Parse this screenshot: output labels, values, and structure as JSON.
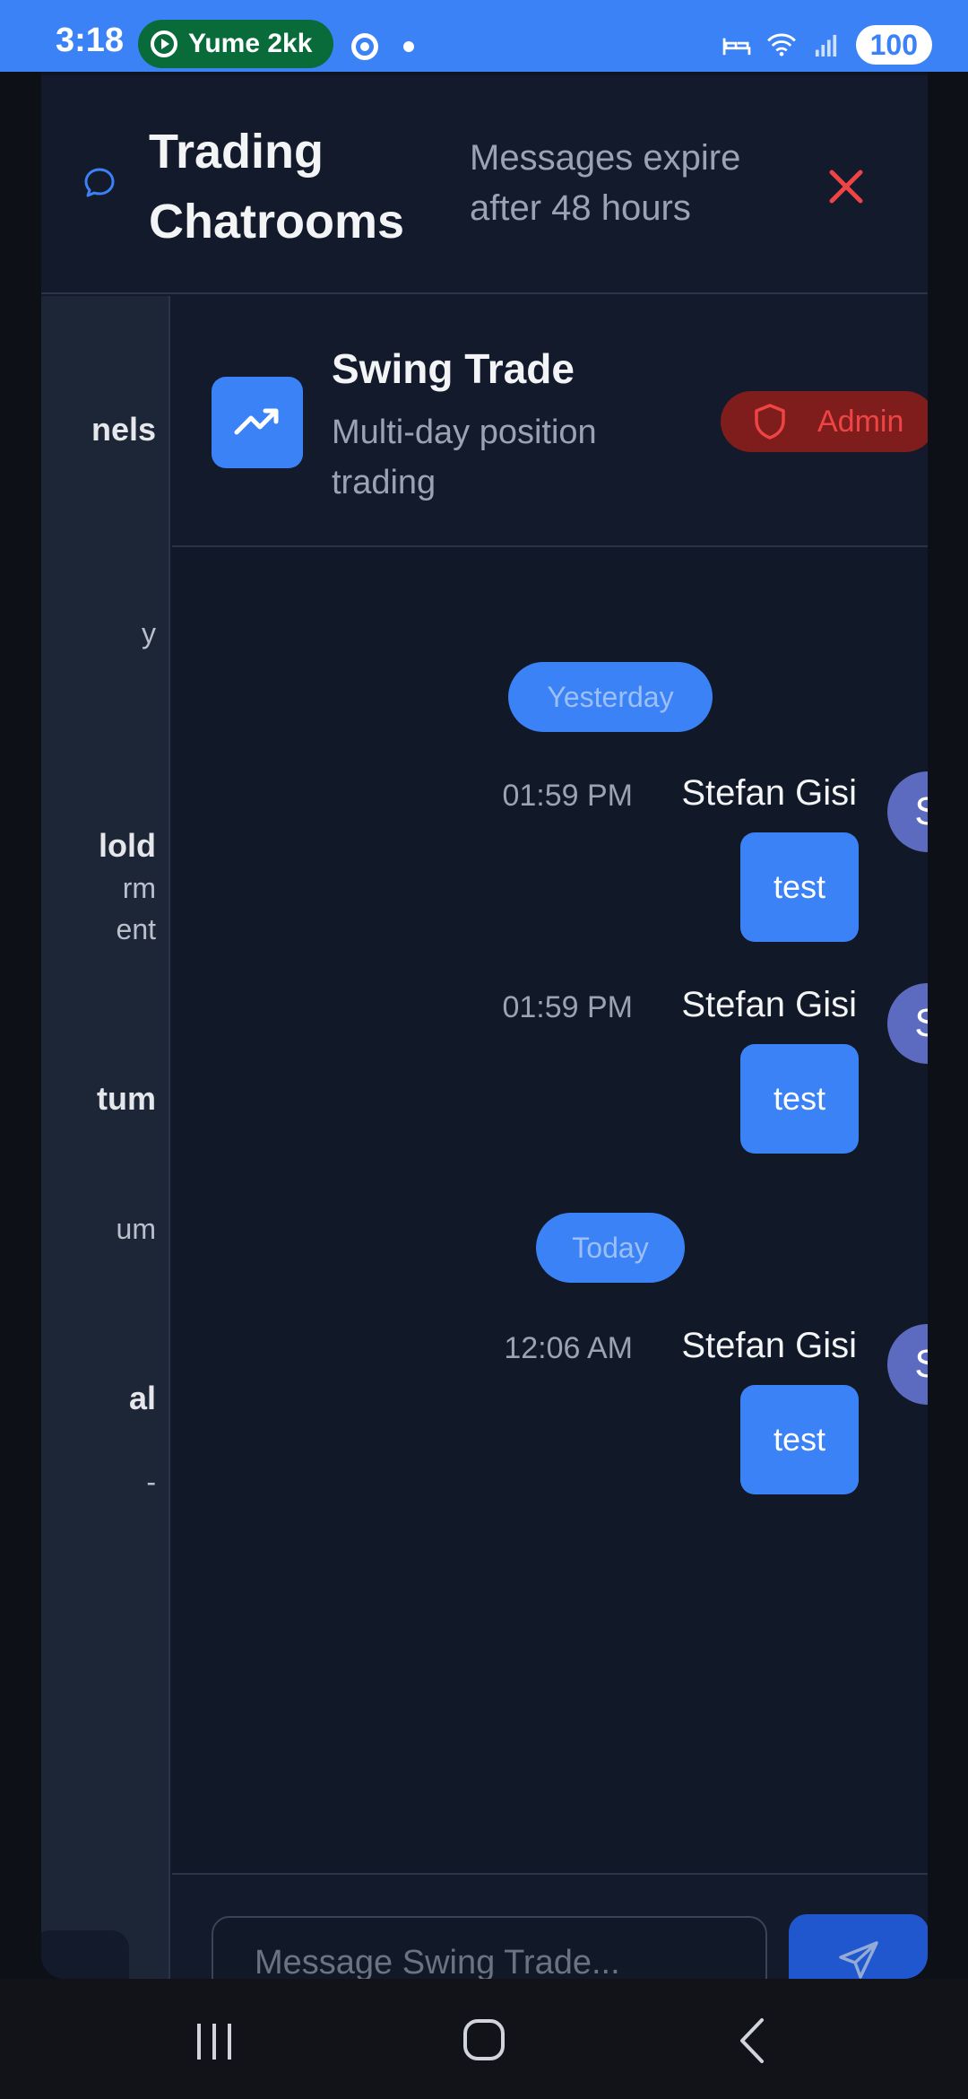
{
  "status_bar": {
    "time": "3:18",
    "media_label": "Yume 2kk",
    "battery": "100"
  },
  "modal": {
    "title": "Trading Chatrooms",
    "expire_note": "Messages expire after 48 hours"
  },
  "sidebar": {
    "items": [
      {
        "label": "nels"
      },
      {
        "label": "y"
      },
      {
        "label": "lold"
      },
      {
        "label": "rm"
      },
      {
        "label": "ent"
      },
      {
        "label": "tum"
      },
      {
        "label": "um"
      },
      {
        "label": "al"
      },
      {
        "label": "-"
      }
    ]
  },
  "channel": {
    "name": "Swing Trade",
    "description": "Multi-day position trading",
    "badge": "Admin"
  },
  "messages": {
    "day_1": "Yesterday",
    "day_2": "Today",
    "items": [
      {
        "time": "01:59 PM",
        "author": "Stefan Gisi",
        "initial": "S",
        "text": "test"
      },
      {
        "time": "01:59 PM",
        "author": "Stefan Gisi",
        "initial": "S",
        "text": "test"
      },
      {
        "time": "12:06 AM",
        "author": "Stefan Gisi",
        "initial": "S",
        "text": "test"
      }
    ]
  },
  "composer": {
    "placeholder": "Message Swing Trade..."
  },
  "colors": {
    "accent": "#3b82f6",
    "danger": "#ef4444",
    "avatar": "#5c6bc0"
  }
}
